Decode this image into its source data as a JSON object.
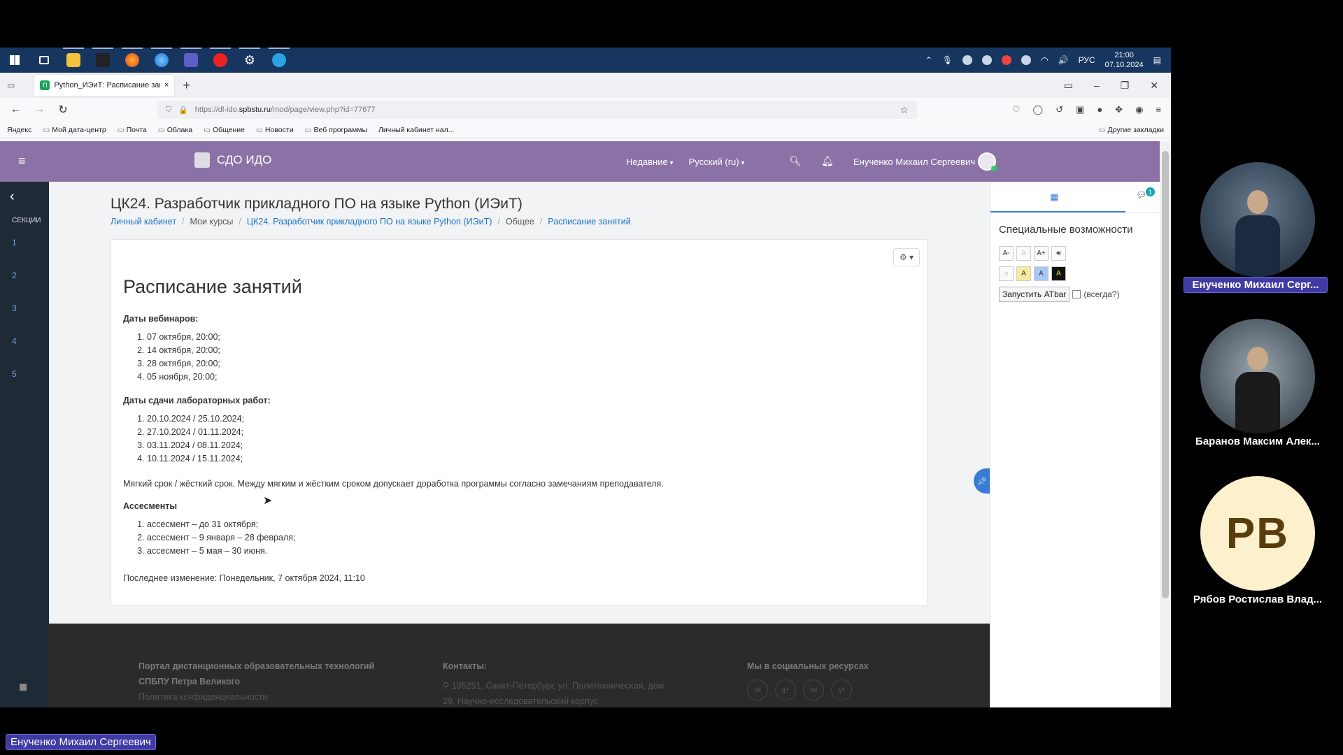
{
  "taskbar": {
    "apps": [
      "windows-start",
      "task-view",
      "file-explorer",
      "game-app",
      "firefox",
      "browser-2",
      "teams",
      "app-red",
      "settings",
      "telegram"
    ],
    "tray": {
      "lang": "РУС",
      "time": "21:00",
      "date": "07.10.2024"
    }
  },
  "browser": {
    "tab_title": "Python_ИЭиТ: Расписание заня",
    "tab_favicon": "П",
    "url_prefix": "https://dl-ido.",
    "url_domain": "spbstu.ru",
    "url_path": "/mod/page/view.php?id=77677",
    "bookmarks": [
      "Яндекс",
      "Мой дата-центр",
      "Почта",
      "Облака",
      "Общение",
      "Новости",
      "Веб программы",
      "Личный кабинет нал..."
    ],
    "other_bookmarks": "Другие закладки"
  },
  "moodle": {
    "brand": "СДО ИДО",
    "nav": {
      "recent": "Недавние",
      "language": "Русский (ru)",
      "user": "Енученко Михаил Сергеевич"
    },
    "sidebar": {
      "label": "СЕКЦИИ",
      "sections": [
        "1",
        "2",
        "3",
        "4",
        "5"
      ]
    },
    "course_title": "ЦК24. Разработчик прикладного ПО на языке Python (ИЭиТ)",
    "breadcrumbs": [
      "Личный кабинет",
      "Мои курсы",
      "ЦК24. Разработчик прикладного ПО на языке Python (ИЭиТ)",
      "Общее",
      "Расписание занятий"
    ],
    "page_heading": "Расписание занятий",
    "webinars": {
      "heading": "Даты вебинаров:",
      "items": [
        "07 октября, 20:00;",
        "14 октября, 20:00;",
        "28 октября, 20:00;",
        "05 ноября, 20:00;"
      ]
    },
    "labs": {
      "heading": "Даты сдачи лабораторных работ:",
      "items": [
        "20.10.2024 / 25.10.2024;",
        "27.10.2024 / 01.11.2024;",
        "03.11.2024 / 08.11.2024;",
        "10.11.2024 / 15.11.2024;"
      ]
    },
    "deadline_note": "Мягкий срок / жёсткий срок. Между мягким и жёстким сроком допускает доработка программы согласно замечаниям преподавателя.",
    "assessments": {
      "heading": "Ассесменты",
      "items": [
        "ассесмент – до 31 октября;",
        "ассесмент – 9 января – 28 февраля;",
        "ассесмент – 5 мая – 30 июня."
      ]
    },
    "last_modified": "Последнее изменение: Понедельник, 7 октября 2024, 11:10",
    "footer": {
      "portal_line1": "Портал дистанционных образовательных технологий",
      "portal_line2": "СПБПУ Петра Великого",
      "privacy": "Политика конфиденциальности",
      "contacts_heading": "Контакты:",
      "address_line1": "195251, Санкт-Петербург, ул. Политехническая, дом",
      "address_line2": "29, Научно-исследовательский корпус",
      "social_heading": "Мы в социальных ресурсах",
      "social": [
        "vk",
        "g+",
        "tw",
        "yt"
      ]
    },
    "right_panel": {
      "title": "Специальные возможности",
      "badge": "1",
      "font_buttons": [
        "A-",
        "A",
        "A+"
      ],
      "color_buttons": [
        "A",
        "A",
        "A"
      ],
      "atbar_button": "Запустить ATbar",
      "atbar_always": "(всегда?)"
    }
  },
  "participants": [
    {
      "name": "Енученко Михаил Серг...",
      "active": true
    },
    {
      "name": "Баранов Максим Алек...",
      "active": false
    },
    {
      "name": "Рябов Ростислав Влад...",
      "initials": "PB",
      "active": false
    }
  ],
  "speaker": "Енученко Михаил Сергеевич"
}
